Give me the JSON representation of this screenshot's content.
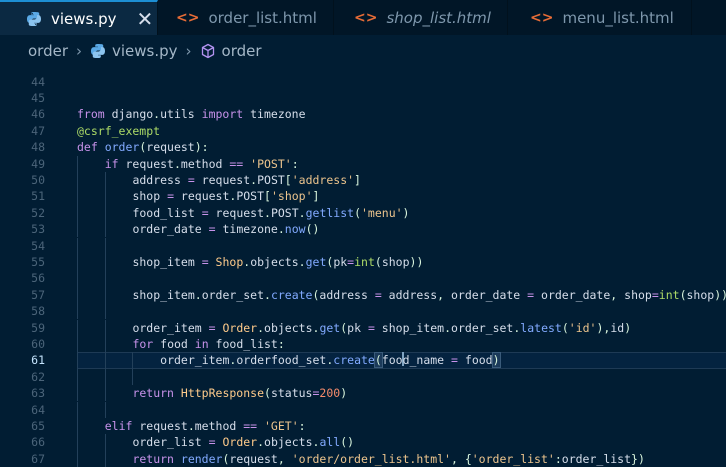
{
  "tabs": [
    {
      "label": "views.py",
      "icon": "python-icon",
      "active": true,
      "close": "✕"
    },
    {
      "label": "order_list.html",
      "icon": "html-icon",
      "active": false
    },
    {
      "label": "shop_list.html",
      "icon": "html-icon",
      "active": false,
      "italic": true
    },
    {
      "label": "menu_list.html",
      "icon": "html-icon",
      "active": false
    }
  ],
  "breadcrumb": {
    "folder": "order",
    "file": "views.py",
    "symbol": "order"
  },
  "current_line": 61,
  "lines": [
    {
      "n": 44,
      "indent": 0,
      "tokens": []
    },
    {
      "n": 45,
      "indent": 0,
      "tokens": []
    },
    {
      "n": 46,
      "indent": 0,
      "tokens": [
        [
          "k",
          "from "
        ],
        [
          "v",
          "django"
        ],
        [
          "p",
          "."
        ],
        [
          "v",
          "utils "
        ],
        [
          "k",
          "import "
        ],
        [
          "v",
          "timezone"
        ]
      ]
    },
    {
      "n": 47,
      "indent": 0,
      "tokens": [
        [
          "d",
          "@csrf_exempt"
        ]
      ]
    },
    {
      "n": 48,
      "indent": 0,
      "tokens": [
        [
          "k",
          "def "
        ],
        [
          "f",
          "order"
        ],
        [
          "p",
          "("
        ],
        [
          "v",
          "request"
        ],
        [
          "p",
          "):"
        ]
      ]
    },
    {
      "n": 49,
      "indent": 1,
      "tokens": [
        [
          "k",
          "if "
        ],
        [
          "v",
          "request"
        ],
        [
          "p",
          "."
        ],
        [
          "v",
          "method "
        ],
        [
          "o",
          "== "
        ],
        [
          "s",
          "'POST'"
        ],
        [
          "p",
          ":"
        ]
      ]
    },
    {
      "n": 50,
      "indent": 2,
      "tokens": [
        [
          "v",
          "address "
        ],
        [
          "o",
          "= "
        ],
        [
          "v",
          "request"
        ],
        [
          "p",
          "."
        ],
        [
          "v",
          "POST"
        ],
        [
          "p",
          "["
        ],
        [
          "s",
          "'address'"
        ],
        [
          "p",
          "]"
        ]
      ]
    },
    {
      "n": 51,
      "indent": 2,
      "tokens": [
        [
          "v",
          "shop "
        ],
        [
          "o",
          "= "
        ],
        [
          "v",
          "request"
        ],
        [
          "p",
          "."
        ],
        [
          "v",
          "POST"
        ],
        [
          "p",
          "["
        ],
        [
          "s",
          "'shop'"
        ],
        [
          "p",
          "]"
        ]
      ]
    },
    {
      "n": 52,
      "indent": 2,
      "tokens": [
        [
          "v",
          "food_list "
        ],
        [
          "o",
          "= "
        ],
        [
          "v",
          "request"
        ],
        [
          "p",
          "."
        ],
        [
          "v",
          "POST"
        ],
        [
          "p",
          "."
        ],
        [
          "f",
          "getlist"
        ],
        [
          "p",
          "("
        ],
        [
          "s",
          "'menu'"
        ],
        [
          "p",
          ")"
        ]
      ]
    },
    {
      "n": 53,
      "indent": 2,
      "tokens": [
        [
          "v",
          "order_date "
        ],
        [
          "o",
          "= "
        ],
        [
          "v",
          "timezone"
        ],
        [
          "p",
          "."
        ],
        [
          "f",
          "now"
        ],
        [
          "p",
          "()"
        ]
      ]
    },
    {
      "n": 54,
      "indent": 2,
      "tokens": []
    },
    {
      "n": 55,
      "indent": 2,
      "tokens": [
        [
          "v",
          "shop_item "
        ],
        [
          "o",
          "= "
        ],
        [
          "cls",
          "Shop"
        ],
        [
          "p",
          "."
        ],
        [
          "v",
          "objects"
        ],
        [
          "p",
          "."
        ],
        [
          "f",
          "get"
        ],
        [
          "p",
          "("
        ],
        [
          "v",
          "pk"
        ],
        [
          "o",
          "="
        ],
        [
          "b",
          "int"
        ],
        [
          "p",
          "("
        ],
        [
          "v",
          "shop"
        ],
        [
          "p",
          "))"
        ]
      ]
    },
    {
      "n": 56,
      "indent": 2,
      "tokens": []
    },
    {
      "n": 57,
      "indent": 2,
      "tokens": [
        [
          "v",
          "shop_item"
        ],
        [
          "p",
          "."
        ],
        [
          "v",
          "order_set"
        ],
        [
          "p",
          "."
        ],
        [
          "f",
          "create"
        ],
        [
          "p",
          "("
        ],
        [
          "v",
          "address "
        ],
        [
          "o",
          "= "
        ],
        [
          "v",
          "address"
        ],
        [
          "p",
          ", "
        ],
        [
          "v",
          "order_date "
        ],
        [
          "o",
          "= "
        ],
        [
          "v",
          "order_date"
        ],
        [
          "p",
          ", "
        ],
        [
          "v",
          "shop"
        ],
        [
          "o",
          "="
        ],
        [
          "b",
          "int"
        ],
        [
          "p",
          "("
        ],
        [
          "v",
          "shop"
        ],
        [
          "p",
          "))"
        ]
      ]
    },
    {
      "n": 58,
      "indent": 2,
      "tokens": []
    },
    {
      "n": 59,
      "indent": 2,
      "tokens": [
        [
          "v",
          "order_item "
        ],
        [
          "o",
          "= "
        ],
        [
          "cls",
          "Order"
        ],
        [
          "p",
          "."
        ],
        [
          "v",
          "objects"
        ],
        [
          "p",
          "."
        ],
        [
          "f",
          "get"
        ],
        [
          "p",
          "("
        ],
        [
          "v",
          "pk "
        ],
        [
          "o",
          "= "
        ],
        [
          "v",
          "shop_item"
        ],
        [
          "p",
          "."
        ],
        [
          "v",
          "order_set"
        ],
        [
          "p",
          "."
        ],
        [
          "f",
          "latest"
        ],
        [
          "p",
          "("
        ],
        [
          "s",
          "'id'"
        ],
        [
          "p",
          "),"
        ],
        [
          "v",
          "id"
        ],
        [
          "p",
          ")"
        ]
      ]
    },
    {
      "n": 60,
      "indent": 2,
      "tokens": [
        [
          "k",
          "for "
        ],
        [
          "v",
          "food "
        ],
        [
          "k",
          "in "
        ],
        [
          "v",
          "food_list"
        ],
        [
          "p",
          ":"
        ]
      ]
    },
    {
      "n": 61,
      "indent": 3,
      "tokens": [
        [
          "v",
          "order_item"
        ],
        [
          "p",
          "."
        ],
        [
          "v",
          "orderfood_set"
        ],
        [
          "p",
          "."
        ],
        [
          "f",
          "create"
        ],
        [
          "hl",
          "("
        ],
        [
          "v",
          "foo"
        ],
        [
          "caret",
          ""
        ],
        [
          "v",
          "d_name "
        ],
        [
          "o",
          "= "
        ],
        [
          "v",
          "food"
        ],
        [
          "hl",
          ")"
        ]
      ]
    },
    {
      "n": 62,
      "indent": 3,
      "tokens": []
    },
    {
      "n": 63,
      "indent": 2,
      "tokens": [
        [
          "k",
          "return "
        ],
        [
          "cls",
          "HttpResponse"
        ],
        [
          "p",
          "("
        ],
        [
          "v",
          "status"
        ],
        [
          "o",
          "="
        ],
        [
          "n",
          "200"
        ],
        [
          "p",
          ")"
        ]
      ]
    },
    {
      "n": 64,
      "indent": 2,
      "tokens": []
    },
    {
      "n": 65,
      "indent": 1,
      "tokens": [
        [
          "k",
          "elif "
        ],
        [
          "v",
          "request"
        ],
        [
          "p",
          "."
        ],
        [
          "v",
          "method "
        ],
        [
          "o",
          "== "
        ],
        [
          "s",
          "'GET'"
        ],
        [
          "p",
          ":"
        ]
      ]
    },
    {
      "n": 66,
      "indent": 2,
      "tokens": [
        [
          "v",
          "order_list "
        ],
        [
          "o",
          "= "
        ],
        [
          "cls",
          "Order"
        ],
        [
          "p",
          "."
        ],
        [
          "v",
          "objects"
        ],
        [
          "p",
          "."
        ],
        [
          "f",
          "all"
        ],
        [
          "p",
          "()"
        ]
      ]
    },
    {
      "n": 67,
      "indent": 2,
      "tokens": [
        [
          "k",
          "return "
        ],
        [
          "f",
          "render"
        ],
        [
          "p",
          "("
        ],
        [
          "v",
          "request"
        ],
        [
          "p",
          ", "
        ],
        [
          "s",
          "'order/order_list.html'"
        ],
        [
          "p",
          ", {"
        ],
        [
          "s",
          "'order_list'"
        ],
        [
          "p",
          ":"
        ],
        [
          "v",
          "order_list"
        ],
        [
          "p",
          "})"
        ]
      ]
    }
  ]
}
